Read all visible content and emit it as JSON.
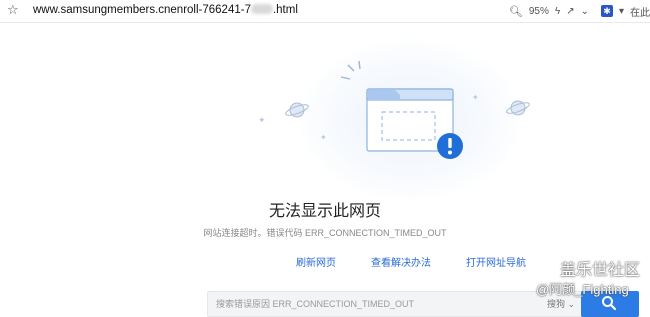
{
  "browser": {
    "url_prefix": "www.samsungmembers.cnenroll-766241-7",
    "url_suffix": ".html",
    "zoom": "95%",
    "right_cut_text": "在此"
  },
  "error": {
    "title": "无法显示此网页",
    "detail": "网站连接超时。错误代码 ERR_CONNECTION_TIMED_OUT",
    "links": [
      "刷新网页",
      "查看解决办法",
      "打开网址导航"
    ]
  },
  "search": {
    "placeholder": "搜索错误原因 ERR_CONNECTION_TIMED_OUT",
    "engine": "搜狗 ⌄"
  },
  "watermark": {
    "line1": "盖乐世社区",
    "line2": "@阿颜_Fighting"
  },
  "colors": {
    "accent": "#2d7be5",
    "link": "#2a6ad8",
    "alert": "#1f6fd6"
  }
}
